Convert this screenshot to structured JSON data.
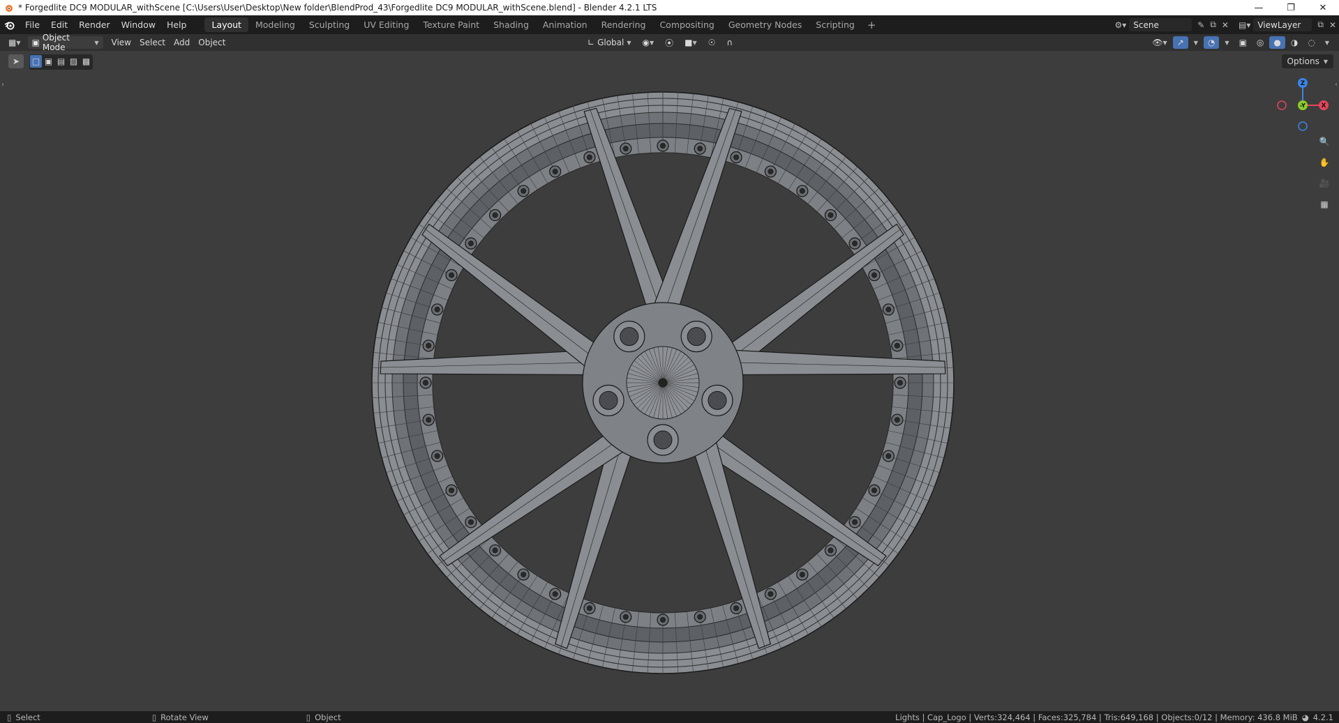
{
  "window": {
    "title": "* Forgedlite DC9 MODULAR_withScene [C:\\Users\\User\\Desktop\\New folder\\BlendProd_43\\Forgedlite DC9 MODULAR_withScene.blend] - Blender 4.2.1 LTS"
  },
  "menu": [
    "File",
    "Edit",
    "Render",
    "Window",
    "Help"
  ],
  "workspaces": [
    "Layout",
    "Modeling",
    "Sculpting",
    "UV Editing",
    "Texture Paint",
    "Shading",
    "Animation",
    "Rendering",
    "Compositing",
    "Geometry Nodes",
    "Scripting"
  ],
  "active_workspace": "Layout",
  "scene": {
    "name": "Scene",
    "view_layer": "ViewLayer"
  },
  "viewport_header": {
    "mode": "Object Mode",
    "menus": [
      "View",
      "Select",
      "Add",
      "Object"
    ],
    "orientation": "Global"
  },
  "viewport": {
    "options_label": "Options",
    "gizmo": {
      "z": "Z",
      "y": "-Y",
      "x": "X"
    }
  },
  "status": {
    "hints": [
      "Select",
      "Rotate View",
      "Object"
    ],
    "stats": "Lights | Cap_Logo | Verts:324,464 | Faces:325,784 | Tris:649,168 | Objects:0/12 | Memory: 436.8 MiB",
    "version": "4.2.1"
  },
  "colors": {
    "accent": "#4772b3",
    "axis_x": "#e5455a",
    "axis_y": "#8bcc29",
    "axis_z": "#3a86e8",
    "viewport_bg": "#3d3d3d"
  }
}
